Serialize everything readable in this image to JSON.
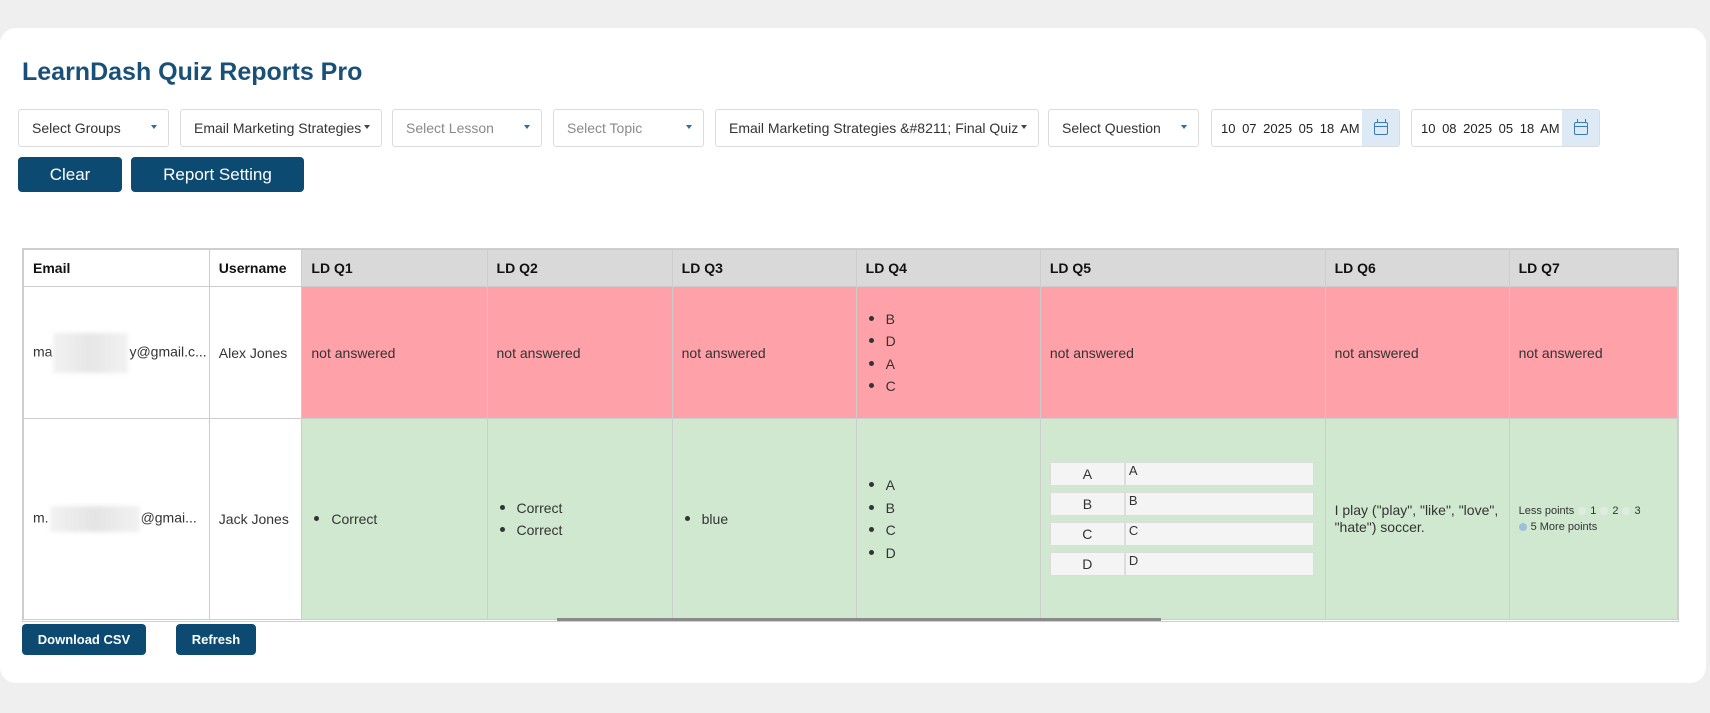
{
  "app": {
    "title": "LearnDash Quiz Reports Pro"
  },
  "filters": {
    "groups": "Select Groups",
    "course": "Email Marketing Strategies",
    "lesson": "Select Lesson",
    "topic": "Select Topic",
    "quiz": "Email Marketing Strategies &#8211; Final Quiz",
    "question": "Select Question",
    "date_from": "10 07 2025 05 18 AM",
    "date_to": "10 08 2025 05 18 AM"
  },
  "buttons": {
    "clear": "Clear",
    "report_setting": "Report Setting",
    "download_csv": "Download CSV",
    "refresh": "Refresh"
  },
  "table": {
    "headers": [
      "Email",
      "Username",
      "LD Q1",
      "LD Q2",
      "LD Q3",
      "LD Q4",
      "LD Q5",
      "LD Q6",
      "LD Q7"
    ],
    "rows": [
      {
        "status": "incorrect",
        "email_start": "ma",
        "email_end": "y@gmail.c...",
        "username": "Alex Jones",
        "q1": "not answered",
        "q2": "not answered",
        "q3": "not answered",
        "q4": [
          "B",
          "D",
          "A",
          "C"
        ],
        "q5": "not answered",
        "q6": "not answered",
        "q7": "not answered"
      },
      {
        "status": "correct",
        "email_start": "m.",
        "email_end": "@gmai...",
        "username": "Jack Jones",
        "q1": [
          "Correct"
        ],
        "q2": [
          "Correct",
          "Correct"
        ],
        "q3": [
          "blue"
        ],
        "q4": [
          "A",
          "B",
          "C",
          "D"
        ],
        "q5": [
          {
            "left": "A",
            "right": "A"
          },
          {
            "left": "B",
            "right": "B"
          },
          {
            "left": "C",
            "right": "C"
          },
          {
            "left": "D",
            "right": "D"
          }
        ],
        "q6": "I play (\"play\", \"like\", \"love\", \"hate\") soccer.",
        "q7": {
          "less_label": "Less points",
          "scale": [
            "1",
            "2",
            "3"
          ],
          "more_label": "5 More points"
        }
      }
    ]
  },
  "colors": {
    "brand": "#0c4a72",
    "title": "#1a5078",
    "incorrect_row": "#ffa1a8",
    "correct_row": "#cfe8cf",
    "header_bg": "#d9d9d9"
  }
}
